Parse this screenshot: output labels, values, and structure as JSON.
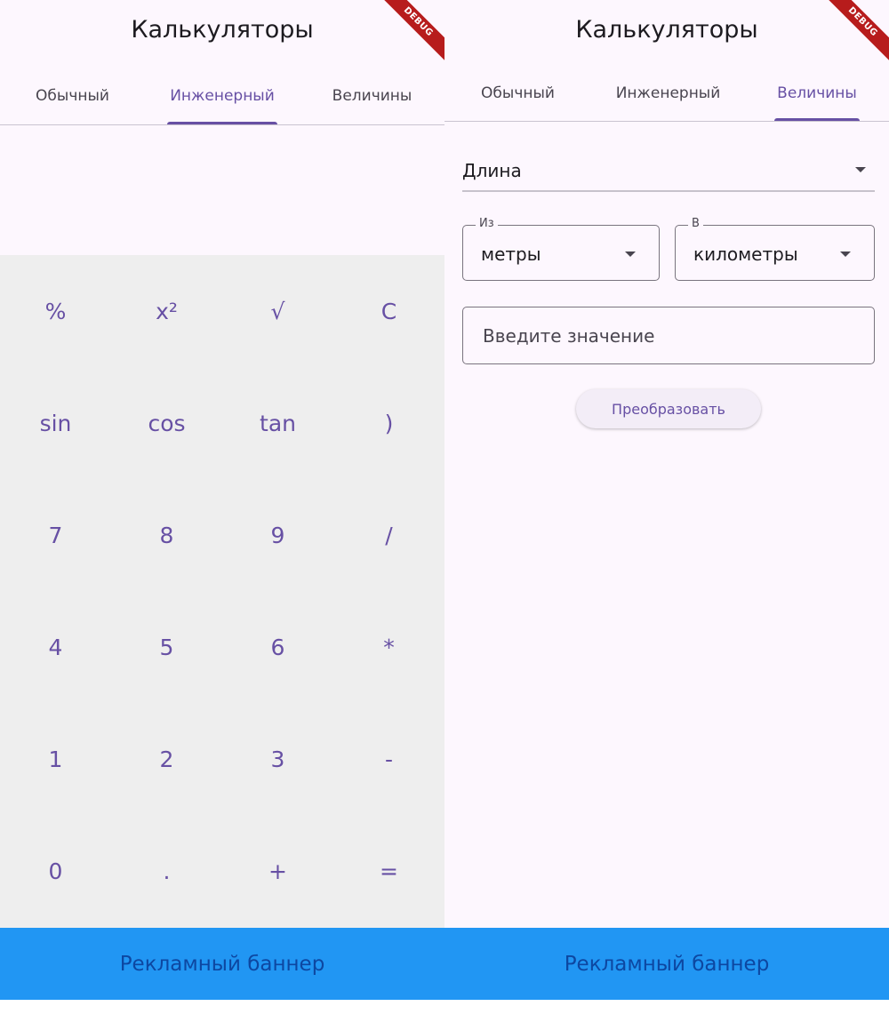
{
  "app_title": "Калькуляторы",
  "debug_label": "DEBUG",
  "tabs": [
    "Обычный",
    "Инженерный",
    "Величины"
  ],
  "engineering": {
    "active_tab": "Инженерный",
    "keys": [
      [
        "%",
        "x²",
        "√",
        "C"
      ],
      [
        "sin",
        "cos",
        "tan",
        ")"
      ],
      [
        "7",
        "8",
        "9",
        "/"
      ],
      [
        "4",
        "5",
        "6",
        "*"
      ],
      [
        "1",
        "2",
        "3",
        "-"
      ],
      [
        "0",
        ".",
        "+",
        "="
      ]
    ]
  },
  "converter": {
    "active_tab": "Величины",
    "quantity": "Длина",
    "from_label": "Из",
    "from_unit": "метры",
    "to_label": "В",
    "to_unit": "километры",
    "value_placeholder": "Введите значение",
    "convert_label": "Преобразовать"
  },
  "ad_banner": "Рекламный баннер",
  "colors": {
    "accent": "#6750a4",
    "ad_banner": "#2196f3",
    "ad_text": "#0d47a1",
    "keypad_bg": "#eeeeee",
    "debug_ribbon": "#b71c1c"
  }
}
